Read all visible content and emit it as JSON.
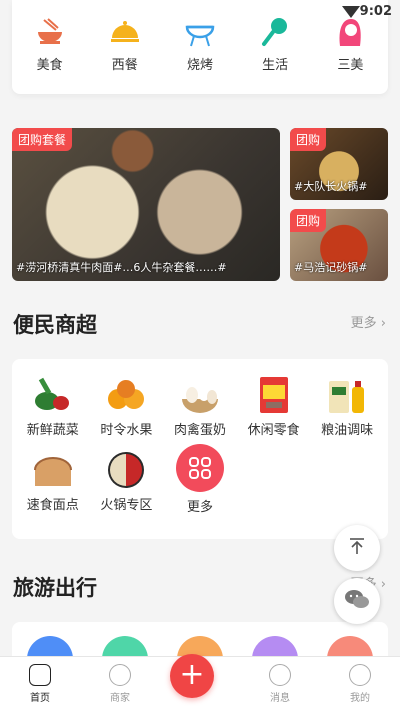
{
  "status": {
    "time": "9:02"
  },
  "categories": [
    {
      "label": "美食",
      "icon": "food-bowl-icon",
      "color": "#e8704a"
    },
    {
      "label": "西餐",
      "icon": "cloche-icon",
      "color": "#f5b21c"
    },
    {
      "label": "烧烤",
      "icon": "grill-icon",
      "color": "#3aa0e8"
    },
    {
      "label": "生活",
      "icon": "microphone-icon",
      "color": "#1ab89a"
    },
    {
      "label": "三美",
      "icon": "woman-icon",
      "color": "#f2467a"
    }
  ],
  "promo": {
    "main": {
      "tag": "团购套餐",
      "caption": "#涝河桥清真牛肉面#…6人牛杂套餐……#"
    },
    "side1": {
      "tag": "团购",
      "caption": "#大队长火锅#"
    },
    "side2": {
      "tag": "团购",
      "caption": "#马浩记砂锅#"
    }
  },
  "mart": {
    "title": "便民商超",
    "more": "更多",
    "items": [
      {
        "label": "新鲜蔬菜",
        "icon": "vegetables-icon"
      },
      {
        "label": "时令水果",
        "icon": "oranges-icon"
      },
      {
        "label": "肉禽蛋奶",
        "icon": "eggs-icon"
      },
      {
        "label": "休闲零食",
        "icon": "snack-bag-icon"
      },
      {
        "label": "粮油调味",
        "icon": "rice-oil-icon"
      },
      {
        "label": "速食面点",
        "icon": "bread-icon"
      },
      {
        "label": "火锅专区",
        "icon": "hotpot-icon"
      },
      {
        "label": "更多",
        "icon": "grid-more-icon"
      }
    ]
  },
  "travel": {
    "title": "旅游出行",
    "more": "更多"
  },
  "tabs": [
    {
      "label": "首页",
      "icon": "home-icon"
    },
    {
      "label": "商家",
      "icon": "shop-icon"
    },
    {
      "label": "",
      "icon": "plus-icon"
    },
    {
      "label": "消息",
      "icon": "message-icon"
    },
    {
      "label": "我的",
      "icon": "profile-icon"
    }
  ],
  "colors": {
    "accent": "#f04545",
    "tag": "#f24b4b"
  }
}
